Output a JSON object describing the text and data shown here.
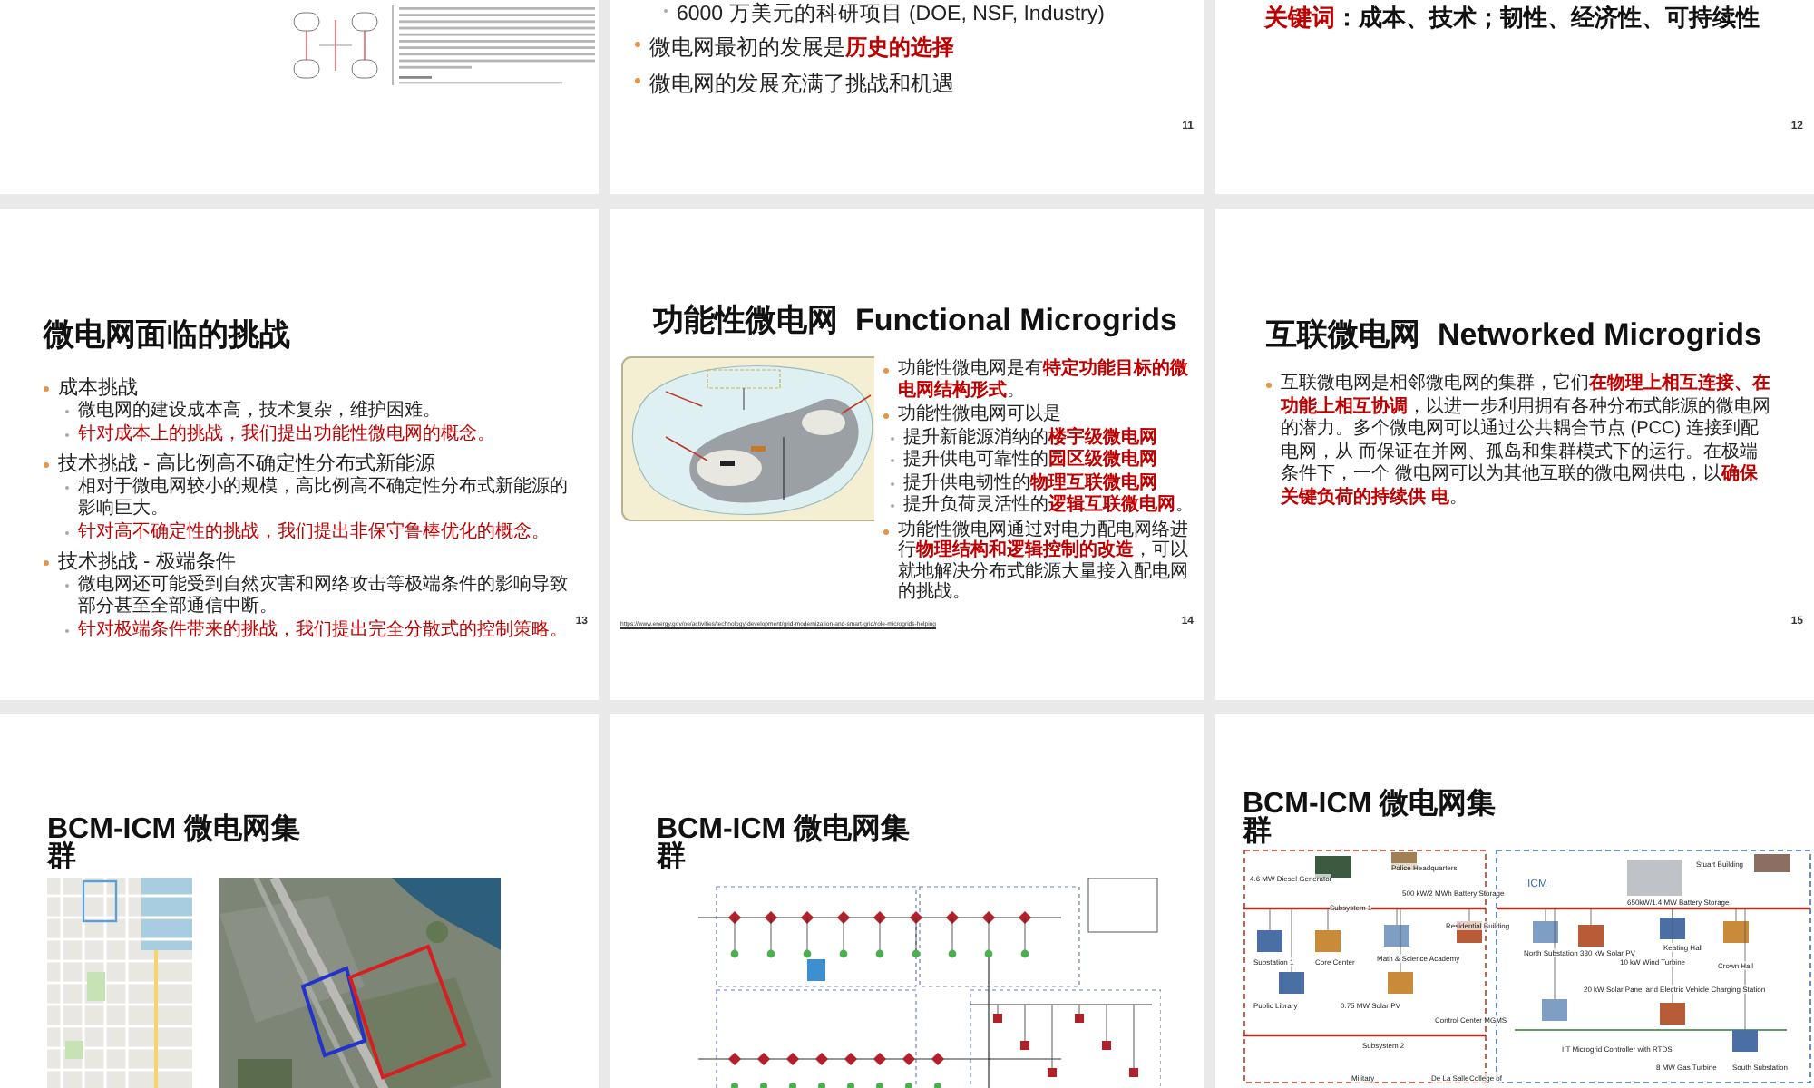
{
  "slides": [
    {
      "kind": "paper"
    },
    {
      "kind": "bullets",
      "number": "11",
      "items": [
        {
          "kind": "sub",
          "text": "6000 万美元的科研项目 (DOE, NSF, Industry)"
        },
        {
          "kind": "main",
          "text": "微电网最初的发展是**历史的选择**"
        },
        {
          "kind": "main",
          "text": "微电网的发展充满了挑战和机遇"
        }
      ]
    },
    {
      "kind": "keywords",
      "number": "12",
      "label": "关键词",
      "text": "：成本、技术；韧性、经济性、可持续性"
    },
    {
      "kind": "challenges",
      "number": "13",
      "title": "微电网面临的挑战",
      "items": [
        {
          "text": "成本挑战",
          "children": [
            {
              "text": "微电网的建设成本高，技术复杂，维护困难。",
              "emphasis": false
            },
            {
              "text": "针对成本上的挑战，我们提出功能性微电网的概念。",
              "emphasis": true
            }
          ]
        },
        {
          "text": "技术挑战 - 高比例高不确定性分布式新能源",
          "children": [
            {
              "text": "相对于微电网较小的规模，高比例高不确定性分布式新能源的影响巨大。",
              "emphasis": false
            },
            {
              "text": "针对高不确定性的挑战，我们提出非保守鲁棒优化的概念。",
              "emphasis": true
            }
          ]
        },
        {
          "text": "技术挑战 - 极端条件",
          "children": [
            {
              "text": "微电网还可能受到自然灾害和网络攻击等极端条件的影响导致部分甚至全部通信中断。",
              "emphasis": false
            },
            {
              "text": "针对极端条件带来的挑战，我们提出完全分散式的控制策略。",
              "emphasis": true
            }
          ]
        }
      ]
    },
    {
      "kind": "functional",
      "number": "14",
      "title": "功能性微电网  Functional Microgrids",
      "items": [
        {
          "text": "功能性微电网是有**特定功能目标的微电网结构形式**。"
        },
        {
          "text": "功能性微电网可以是",
          "children": [
            {
              "text": "提升新能源消纳的**楼宇级微电网**"
            },
            {
              "text": "提升供电可靠性的**园区级微电网**"
            },
            {
              "text": "提升供电韧性的**物理互联微电网**"
            },
            {
              "text": "提升负荷灵活性的**逻辑互联微电网**。"
            }
          ]
        },
        {
          "text": "功能性微电网通过对电力配电网络进行**物理结构和逻辑控制的改造**，可以就地解决分布式能源大量接入配电网的挑战。"
        }
      ],
      "source": "https://www.energy.gov/oe/activities/technology-development/grid-modernization-and-smart-grid/role-microgrids-helping"
    },
    {
      "kind": "networked",
      "number": "15",
      "title": "互联微电网  Networked Microgrids",
      "text": "互联微电网是相邻微电网的集群，它们**在物理上相互连接、在功能上相互协调**，以进一步利用拥有各种分布式能源的微电网的潜力。多个微电网可以通过公共耦合节点 (PCC) 连接到配电网，从 而保证在并网、孤岛和集群模式下的运行。在极端条件下，一个 微电网可以为其他互联的微电网供电，以**确保关键负荷的持续供 电**。"
    },
    {
      "kind": "maps",
      "title": "BCM-ICM  微电网集群"
    },
    {
      "kind": "schematic",
      "title": "BCM-ICM  微电网集群"
    },
    {
      "kind": "campus",
      "title": "BCM-ICM  微电网集群",
      "labels": [
        "ICM",
        "4.6 MW Diesel Generator",
        "Police Headquarters",
        "500 kW/2 MWh Battery Storage",
        "Subsystem 1",
        "Residential Building",
        "Stuart Building",
        "650kW/1.4 MW Battery Storage",
        "Substation 1",
        "Core Center",
        "Math & Science Academy",
        "North Substation",
        "330 kW Solar PV",
        "Keating Hall",
        "10 kW Wind Turbine",
        "Crown Hall",
        "20 kW Solar Panel and Electric Vehicle Charging Station",
        "Public Library",
        "0.75 MW Solar PV",
        "Control Center MGMS",
        "Subsystem 2",
        "IIT Microgrid Controller with RTDS",
        "8 MW Gas Turbine",
        "South Substation",
        "Military",
        "De La Salle",
        "College of"
      ]
    }
  ]
}
